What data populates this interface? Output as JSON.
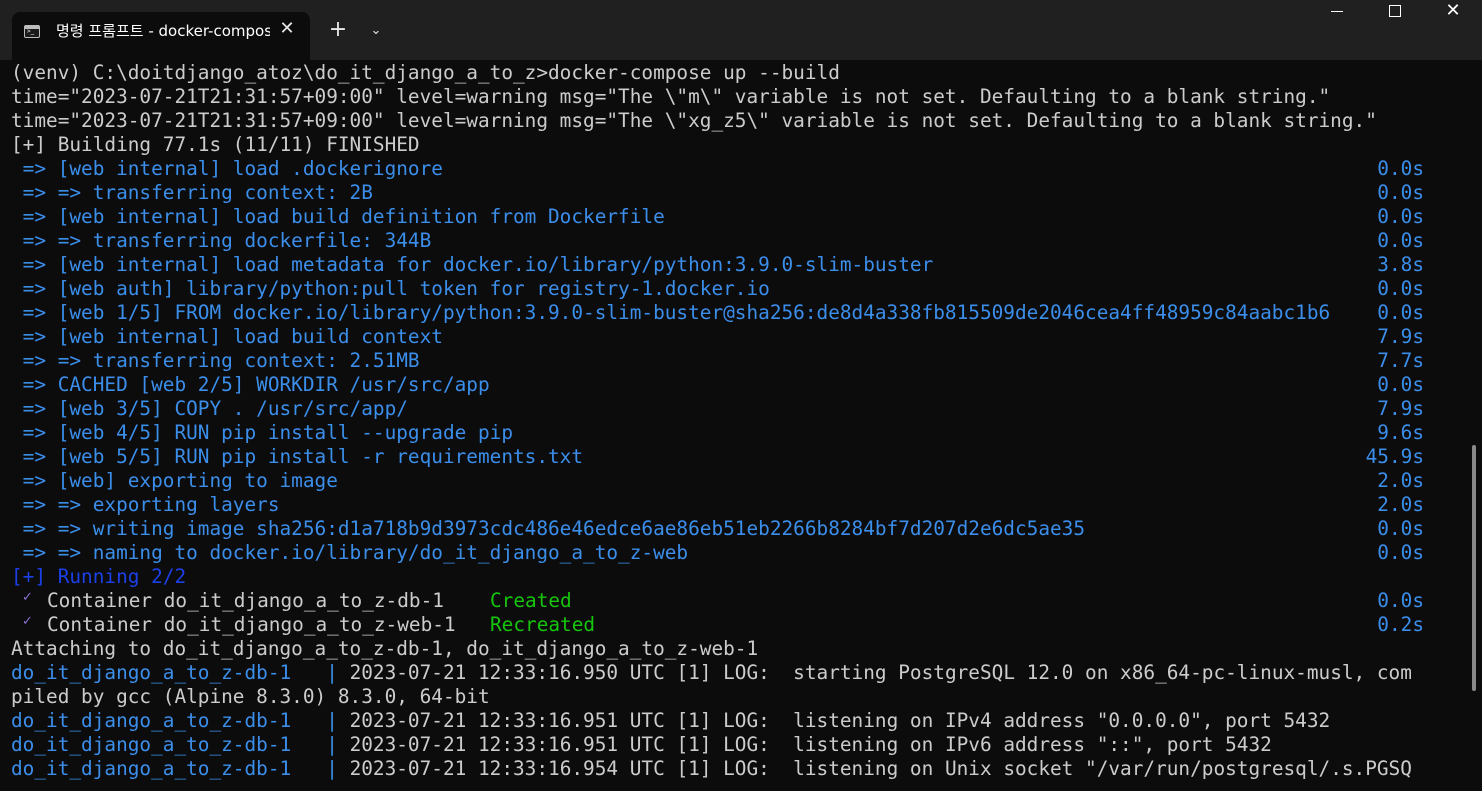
{
  "window": {
    "tab_title": "명령 프롬프트 - docker-compose up --build",
    "tab_close_glyph": "✕",
    "new_tab_glyph": "+",
    "dropdown_glyph": "⌄",
    "close_glyph": "✕"
  },
  "terminal": {
    "command": "(venv) C:\\doitdjango_atoz\\do_it_django_a_to_z>docker-compose up --build",
    "warnings": [
      "time=\"2023-07-21T21:31:57+09:00\" level=warning msg=\"The \\\"m\\\" variable is not set. Defaulting to a blank string.\"",
      "time=\"2023-07-21T21:31:57+09:00\" level=warning msg=\"The \\\"xg_z5\\\" variable is not set. Defaulting to a blank string.\""
    ],
    "build_header": "[+] Building 77.1s (11/11) FINISHED",
    "build_steps": [
      {
        "text": " => [web internal] load .dockerignore",
        "time": "0.0s"
      },
      {
        "text": " => => transferring context: 2B",
        "time": "0.0s"
      },
      {
        "text": " => [web internal] load build definition from Dockerfile",
        "time": "0.0s"
      },
      {
        "text": " => => transferring dockerfile: 344B",
        "time": "0.0s"
      },
      {
        "text": " => [web internal] load metadata for docker.io/library/python:3.9.0-slim-buster",
        "time": "3.8s"
      },
      {
        "text": " => [web auth] library/python:pull token for registry-1.docker.io",
        "time": "0.0s"
      },
      {
        "text": " => [web 1/5] FROM docker.io/library/python:3.9.0-slim-buster@sha256:de8d4a338fb815509de2046cea4ff48959c84aabc1b6",
        "time": "0.0s"
      },
      {
        "text": " => [web internal] load build context",
        "time": "7.9s"
      },
      {
        "text": " => => transferring context: 2.51MB",
        "time": "7.7s"
      },
      {
        "text": " => CACHED [web 2/5] WORKDIR /usr/src/app",
        "time": "0.0s"
      },
      {
        "text": " => [web 3/5] COPY . /usr/src/app/",
        "time": "7.9s"
      },
      {
        "text": " => [web 4/5] RUN pip install --upgrade pip",
        "time": "9.6s"
      },
      {
        "text": " => [web 5/5] RUN pip install -r requirements.txt",
        "time": "45.9s"
      },
      {
        "text": " => [web] exporting to image",
        "time": "2.0s"
      },
      {
        "text": " => => exporting layers",
        "time": "2.0s"
      },
      {
        "text": " => => writing image sha256:d1a718b9d3973cdc486e46edce6ae86eb51eb2266b8284bf7d207d2e6dc5ae35",
        "time": "0.0s"
      },
      {
        "text": " => => naming to docker.io/library/do_it_django_a_to_z-web",
        "time": "0.0s"
      }
    ],
    "running_header": "[+] Running 2/2",
    "containers": [
      {
        "check": "✓",
        "name": "Container do_it_django_a_to_z-db-1",
        "status": "Created",
        "time": "0.0s"
      },
      {
        "check": "✓",
        "name": "Container do_it_django_a_to_z-web-1",
        "status": "Recreated",
        "time": "0.2s"
      }
    ],
    "attaching": "Attaching to do_it_django_a_to_z-db-1, do_it_django_a_to_z-web-1",
    "logs": [
      {
        "prefix": "do_it_django_a_to_z-db-1",
        "sep": "   | ",
        "msg": "2023-07-21 12:33:16.950 UTC [1] LOG:  starting PostgreSQL 12.0 on x86_64-pc-linux-musl, com"
      },
      {
        "prefix": "",
        "sep": "",
        "msg": "piled by gcc (Alpine 8.3.0) 8.3.0, 64-bit"
      },
      {
        "prefix": "do_it_django_a_to_z-db-1",
        "sep": "   | ",
        "msg": "2023-07-21 12:33:16.951 UTC [1] LOG:  listening on IPv4 address \"0.0.0.0\", port 5432"
      },
      {
        "prefix": "do_it_django_a_to_z-db-1",
        "sep": "   | ",
        "msg": "2023-07-21 12:33:16.951 UTC [1] LOG:  listening on IPv6 address \"::\", port 5432"
      },
      {
        "prefix": "do_it_django_a_to_z-db-1",
        "sep": "   | ",
        "msg": "2023-07-21 12:33:16.954 UTC [1] LOG:  listening on Unix socket \"/var/run/postgresql/.s.PGSQ"
      }
    ]
  }
}
